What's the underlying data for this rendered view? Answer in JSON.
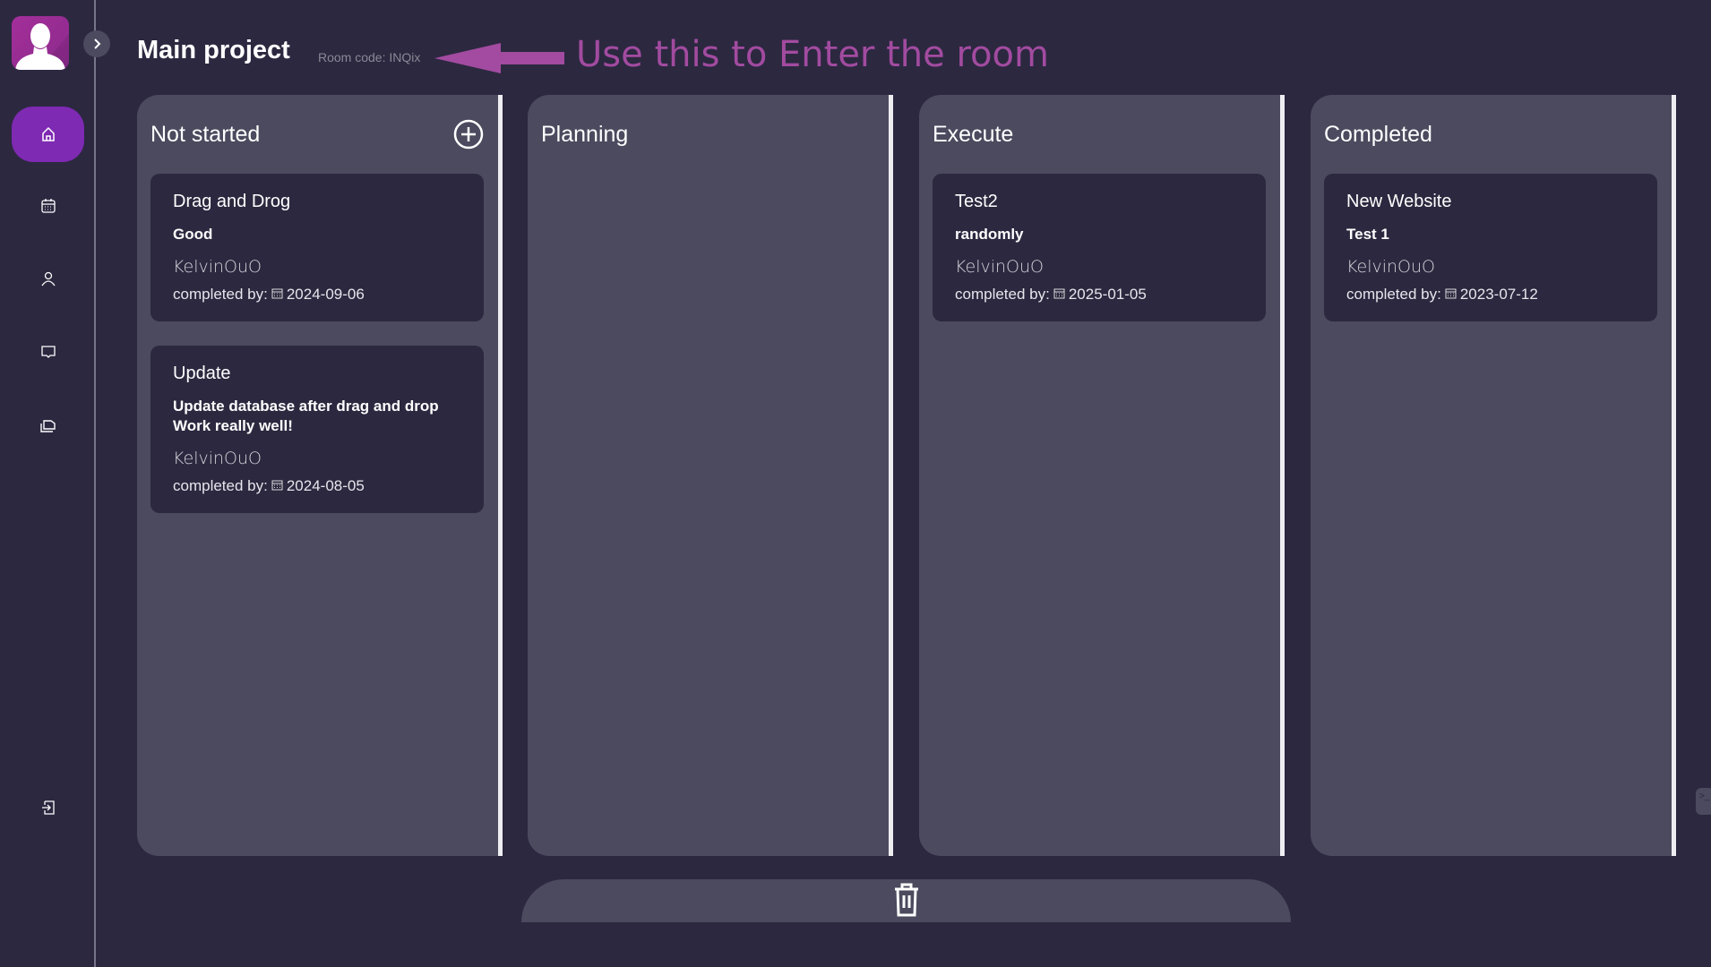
{
  "header": {
    "title": "Main project",
    "room_code": "Room code: INQix",
    "hint": "Use this to Enter the room"
  },
  "sidebar": {
    "items": [
      {
        "name": "home"
      },
      {
        "name": "calendar"
      },
      {
        "name": "profile"
      },
      {
        "name": "chat"
      },
      {
        "name": "projects"
      }
    ],
    "logout": "logout"
  },
  "columns": [
    {
      "title": "Not started",
      "cards": [
        {
          "title": "Drag and Drog",
          "desc": "Good",
          "author": "KelvinOuO",
          "due_label": "completed by:",
          "due": "2024-09-06"
        },
        {
          "title": "Update",
          "desc": "Update database after drag and drop\nWork really well!",
          "author": "KelvinOuO",
          "due_label": "completed by:",
          "due": "2024-08-05"
        }
      ]
    },
    {
      "title": "Planning",
      "cards": []
    },
    {
      "title": "Execute",
      "cards": [
        {
          "title": "Test2",
          "desc": "randomly",
          "author": "KelvinOuO",
          "due_label": "completed by:",
          "due": "2025-01-05"
        }
      ]
    },
    {
      "title": "Completed",
      "cards": [
        {
          "title": "New Website",
          "desc": "Test 1",
          "author": "KelvinOuO",
          "due_label": "completed by:",
          "due": "2023-07-12"
        }
      ]
    }
  ],
  "edge_tab": ">_",
  "colors": {
    "accent": "#7e2ab3",
    "hint": "#a24ba0",
    "bg": "#2c2840",
    "column": "#4b4a5e"
  }
}
